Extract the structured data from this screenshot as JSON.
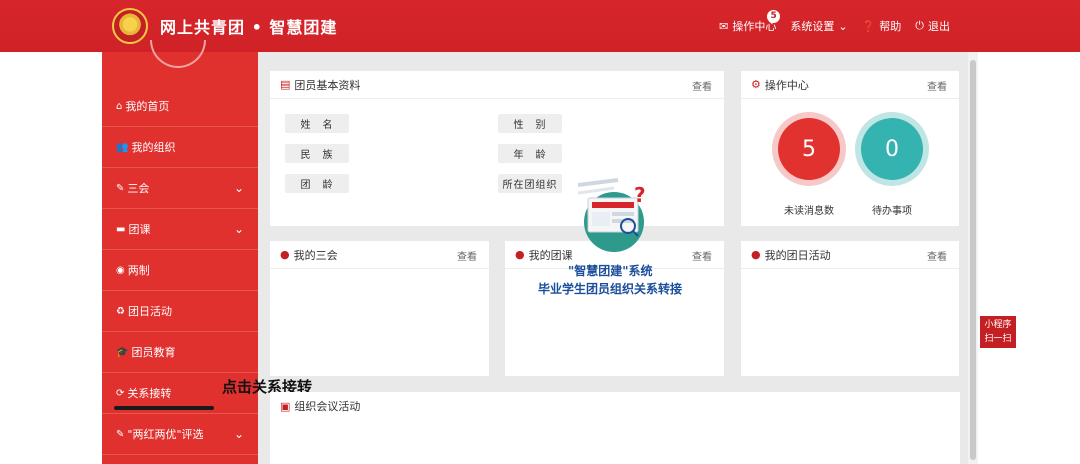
{
  "header": {
    "brand": "网上共青团 • 智慧团建",
    "nav": [
      {
        "label": "操作中心",
        "icon": "envelope-icon",
        "badge": "5"
      },
      {
        "label": "系统设置",
        "icon": "chevron-down-icon"
      },
      {
        "label": "帮助",
        "icon": "question-icon"
      },
      {
        "label": "退出",
        "icon": "power-icon"
      }
    ]
  },
  "sidebar": {
    "items": [
      {
        "label": "我的首页",
        "icon": "home-icon"
      },
      {
        "label": "我的组织",
        "icon": "users-icon"
      },
      {
        "label": "三会",
        "icon": "edit-icon",
        "expandable": true
      },
      {
        "label": "团课",
        "icon": "folder-icon",
        "expandable": true
      },
      {
        "label": "两制",
        "icon": "target-icon"
      },
      {
        "label": "团日活动",
        "icon": "recycle-icon"
      },
      {
        "label": "团员教育",
        "icon": "graduation-cap-icon"
      },
      {
        "label": "关系接转",
        "icon": "refresh-icon"
      },
      {
        "label": "\"两红两优\"评选",
        "icon": "edit-icon",
        "expandable": true
      }
    ]
  },
  "annotation": "点击关系接转",
  "profile_panel": {
    "title": "团员基本资料",
    "more": "查看",
    "fields": [
      "姓　名",
      "性　别",
      "民　族",
      "年　龄",
      "团　龄",
      "所在团组织"
    ]
  },
  "ops_panel": {
    "title": "操作中心",
    "more": "查看",
    "unread_count": "5",
    "unread_label": "未读消息数",
    "todo_count": "0",
    "todo_label": "待办事项"
  },
  "panels": {
    "sanhui": {
      "title": "我的三会",
      "more": "查看"
    },
    "tuanke": {
      "title": "我的团课",
      "more": "查看"
    },
    "tuanri": {
      "title": "我的团日活动",
      "more": "查看"
    },
    "meeting": {
      "title": "组织会议活动"
    }
  },
  "overlay": {
    "title": "\"智慧团建\"系统",
    "subtitle": "毕业学生团员组织关系转接"
  },
  "mini_program": {
    "line1": "小程序",
    "line2": "扫一扫"
  },
  "colors": {
    "brand_red": "#d7262b",
    "sidebar_red": "#e0312f",
    "teal": "#35b3b0",
    "overlay_blue": "#1b4e9b"
  }
}
